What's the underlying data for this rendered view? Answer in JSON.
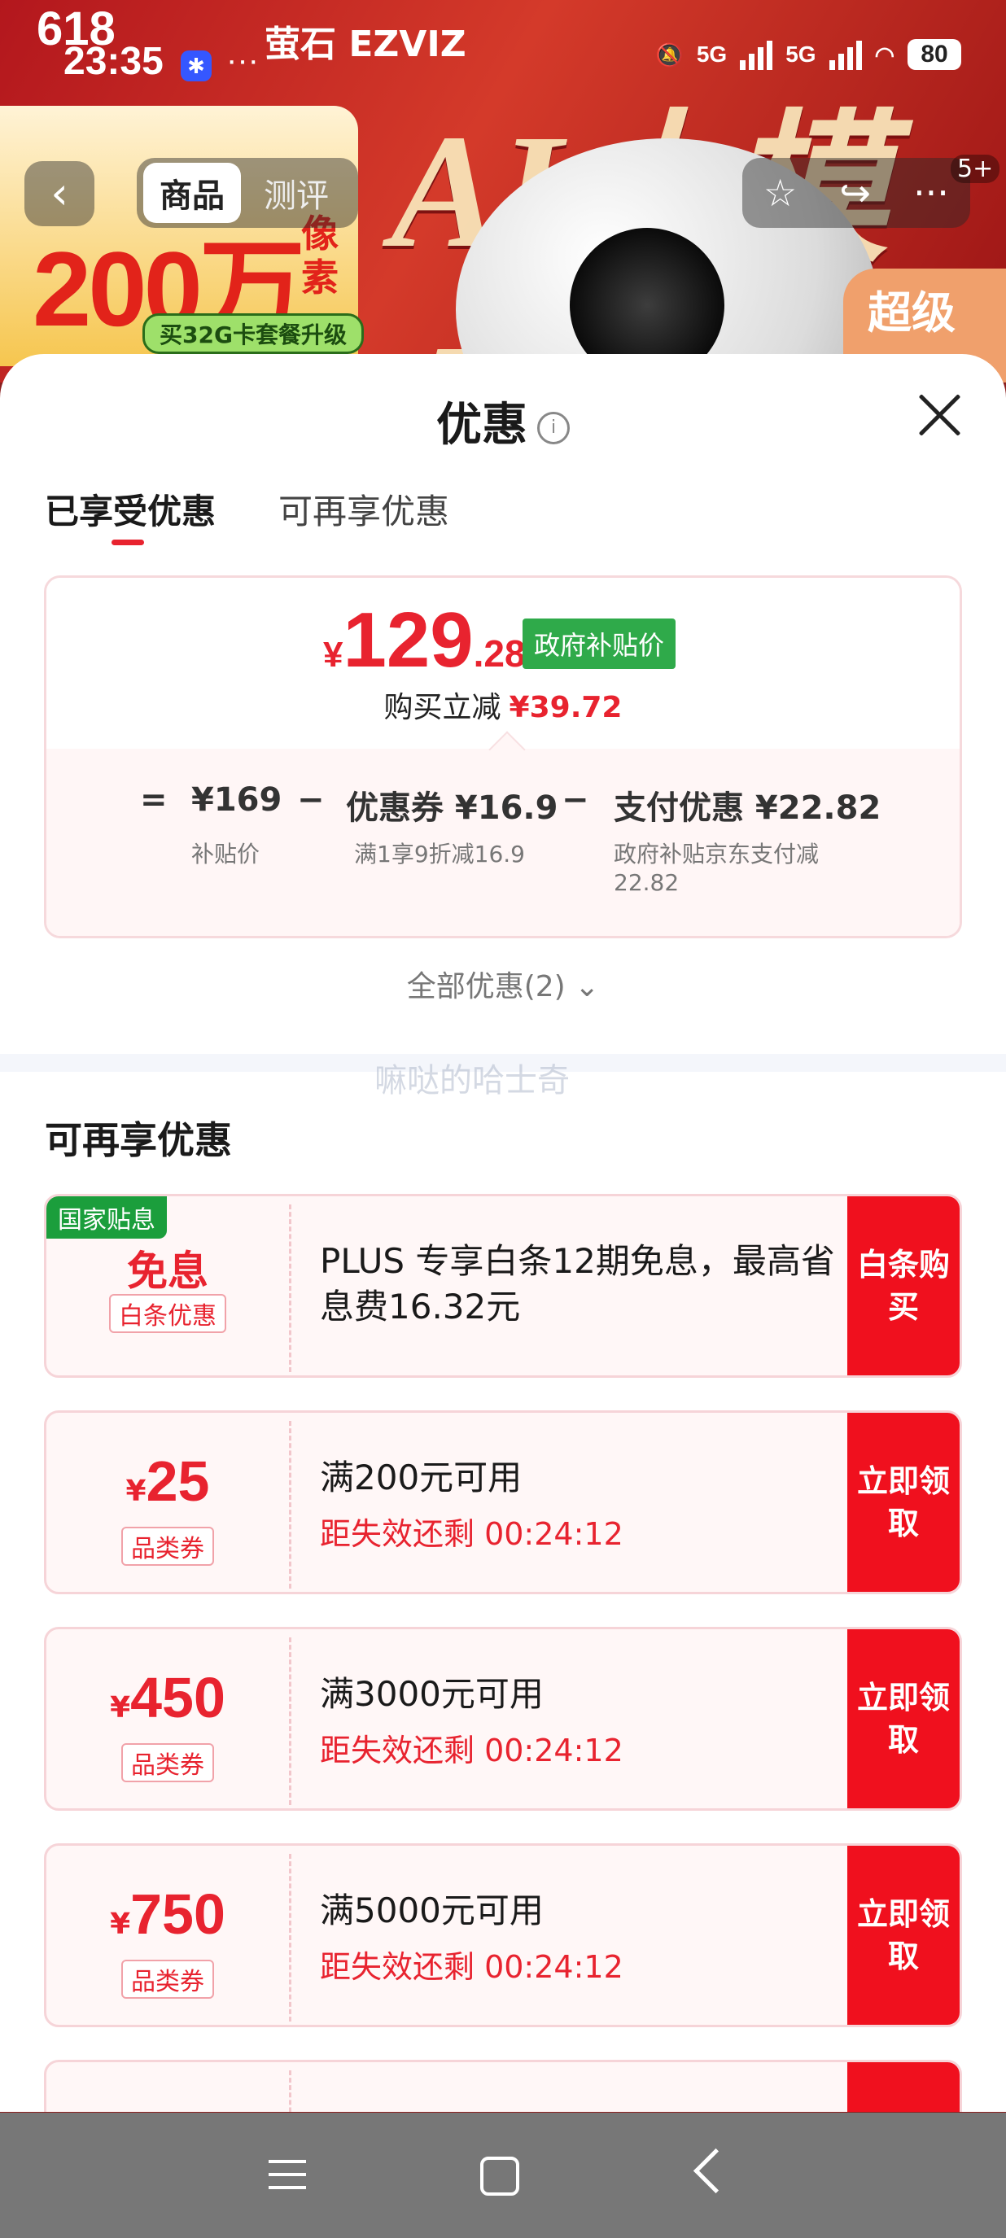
{
  "status": {
    "time": "23:35",
    "battery": "80",
    "net_a": "5G",
    "net_b": "5G"
  },
  "banner": {
    "event": "618",
    "brand": "萤石 EZVIZ",
    "big_text": "200万",
    "side_text": "像素",
    "pill": "买32G卡套餐升级",
    "headline": "AI大模型",
    "corner": "超级"
  },
  "nav": {
    "tab_product": "商品",
    "tab_review": "测评",
    "badge": "5+"
  },
  "sheet": {
    "title": "优惠",
    "tabs": [
      "已享受优惠",
      "可再享优惠"
    ],
    "price": {
      "yen": "¥",
      "int": "129",
      "dec": ".28",
      "tag": "政府补贴价",
      "sub_label": "购买立减",
      "sub_value": "¥39.72"
    },
    "calc": {
      "eq": "=",
      "base": "¥169",
      "base_label": "补贴价",
      "minus1": "−",
      "coupon": "优惠券 ¥16.9",
      "coupon_label": "满1享9折减16.9",
      "minus2": "−",
      "pay": "支付优惠 ¥22.82",
      "pay_label_1": "政府补贴京东支付减",
      "pay_label_2": "22.82"
    },
    "all_offers": "全部优惠(2) ⌄",
    "watermark": "嘛哒的哈士奇",
    "section_title": "可再享优惠",
    "coupons": [
      {
        "tag": "国家贴息",
        "main": "免息",
        "sub": "白条优惠",
        "title": "PLUS 专享白条12期免息，最高省息费16.32元",
        "action": "白条购买"
      },
      {
        "yen": "¥",
        "main": "25",
        "sub": "品类券",
        "title": "满200元可用",
        "timer": "距失效还剩 00:24:12",
        "action": "立即领取"
      },
      {
        "yen": "¥",
        "main": "450",
        "sub": "品类券",
        "title": "满3000元可用",
        "timer": "距失效还剩 00:24:12",
        "action": "立即领取"
      },
      {
        "yen": "¥",
        "main": "750",
        "sub": "品类券",
        "title": "满5000元可用",
        "timer": "距失效还剩 00:24:12",
        "action": "立即领取"
      }
    ]
  },
  "colors": {
    "accent_red": "#e8232f",
    "action_red": "#f0101e",
    "gov_green": "#2faa4a"
  }
}
